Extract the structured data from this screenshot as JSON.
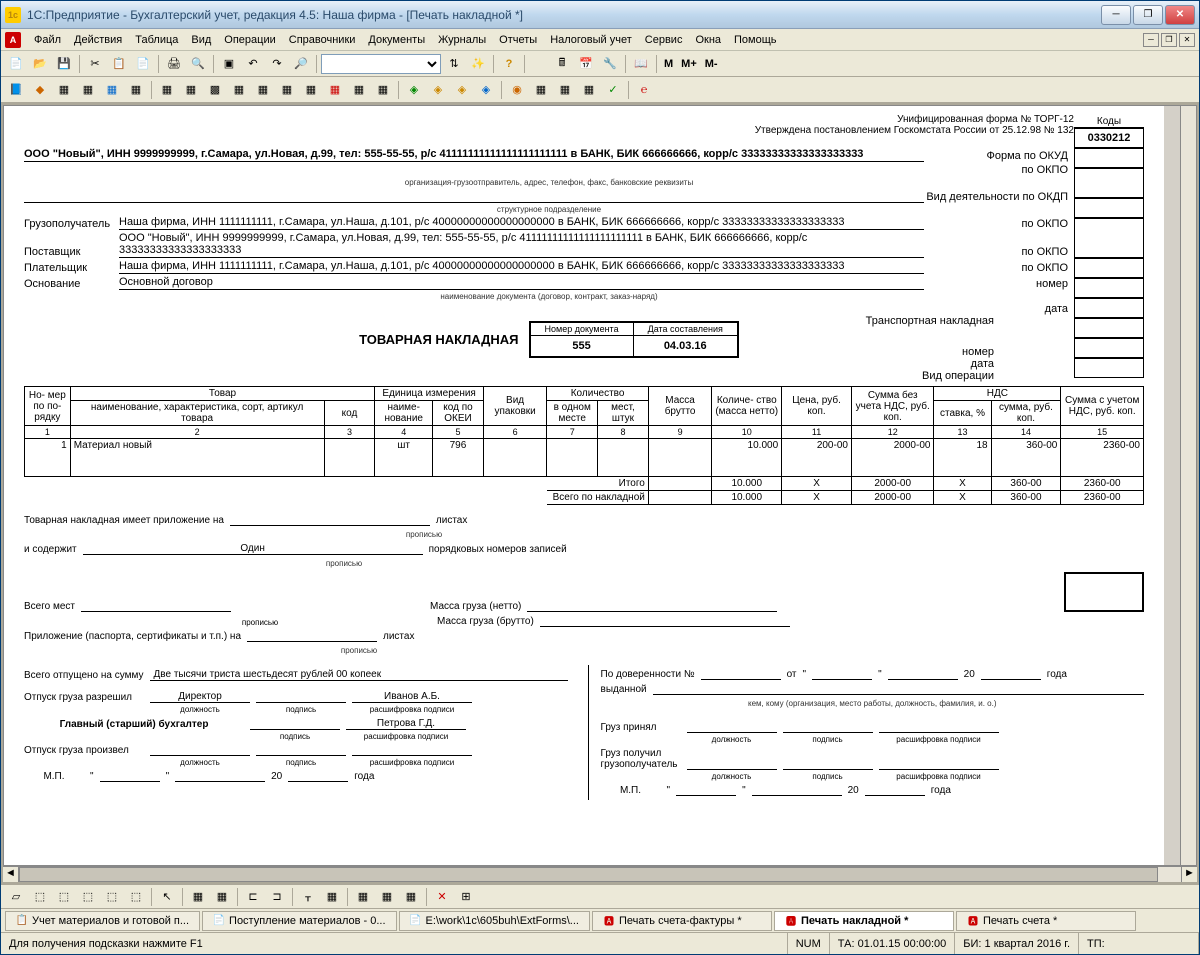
{
  "window": {
    "title": "1С:Предприятие - Бухгалтерский учет, редакция 4.5: Наша фирма - [Печать накладной *]"
  },
  "menu": [
    "Файл",
    "Действия",
    "Таблица",
    "Вид",
    "Операции",
    "Справочники",
    "Документы",
    "Журналы",
    "Отчеты",
    "Налоговый учет",
    "Сервис",
    "Окна",
    "Помощь"
  ],
  "header": {
    "form_line1": "Унифицированная форма № ТОРГ-12",
    "form_line2": "Утверждена постановлением Госкомстата России от 25.12.98 № 132",
    "codes_header": "Коды",
    "okud": "0330212",
    "okud_label": "Форма по ОКУД",
    "okpo_label": "по ОКПО",
    "okdp_label": "Вид деятельности по ОКДП",
    "nomer_label": "номер",
    "data_label": "дата",
    "trans_label": "Транспортная накладная",
    "vid_op_label": "Вид операции"
  },
  "org": {
    "sender": "ООО \"Новый\", ИНН 9999999999, г.Самара, ул.Новая, д.99, тел: 555-55-55, р/с 41111111111111111111111 в БАНК, БИК 666666666, корр/с 33333333333333333333",
    "sender_note": "организация-грузоотправитель, адрес, телефон, факс, банковские реквизиты",
    "struct_note": "структурное подразделение",
    "consignee_label": "Грузополучатель",
    "consignee": "Наша фирма, ИНН 1111111111, г.Самара, ул.Наша, д.101, р/с 40000000000000000000 в БАНК, БИК 666666666, корр/с 33333333333333333333",
    "supplier_label": "Поставщик",
    "supplier": "ООО \"Новый\", ИНН 9999999999, г.Самара, ул.Новая, д.99, тел: 555-55-55, р/с 41111111111111111111111 в БАНК, БИК 666666666, корр/с 33333333333333333333",
    "payer_label": "Плательщик",
    "payer": "Наша фирма, ИНН 1111111111, г.Самара, ул.Наша, д.101, р/с 40000000000000000000 в БАНК, БИК 666666666, корр/с 33333333333333333333",
    "basis_label": "Основание",
    "basis": "Основной договор",
    "basis_note": "наименование документа (договор, контракт, заказ-наряд)"
  },
  "doc": {
    "title": "ТОВАРНАЯ НАКЛАДНАЯ",
    "num_label": "Номер документа",
    "num": "555",
    "date_label": "Дата составления",
    "date": "04.03.16"
  },
  "table": {
    "headers": {
      "h1": "Но-\nмер\nпо по-\nрядку",
      "h2": "Товар",
      "h2a": "наименование, характеристика, сорт,\nартикул товара",
      "h2b": "код",
      "h3": "Единица измерения",
      "h3a": "наиме-\nнование",
      "h3b": "код по\nОКЕИ",
      "h4": "Вид\nупаковки",
      "h5": "Количество",
      "h5a": "в\nодном\nместе",
      "h5b": "мест,\nштук",
      "h6": "Масса\nбрутто",
      "h7": "Количе-\nство\n(масса\nнетто)",
      "h8": "Цена,\nруб. коп.",
      "h9": "Сумма без\nучета НДС,\nруб. коп.",
      "h10": "НДС",
      "h10a": "ставка,\n%",
      "h10b": "сумма,\nруб. коп.",
      "h11": "Сумма с\nучетом\nНДС,\nруб. коп."
    },
    "nums": [
      "1",
      "2",
      "3",
      "4",
      "5",
      "6",
      "7",
      "8",
      "9",
      "10",
      "11",
      "12",
      "13",
      "14",
      "15"
    ],
    "row": {
      "n": "1",
      "name": "Материал новый",
      "code": "",
      "unit": "шт",
      "okei": "796",
      "pack": "",
      "in_one": "",
      "places": "",
      "gross": "",
      "qty": "10.000",
      "price": "200-00",
      "sum_no_vat": "2000-00",
      "vat_rate": "18",
      "vat_sum": "360-00",
      "sum_vat": "2360-00"
    },
    "itogo_label": "Итого",
    "vsego_label": "Всего по накладной",
    "itogo": {
      "qty": "10.000",
      "price": "X",
      "sum_no_vat": "2000-00",
      "vat_rate": "X",
      "vat_sum": "360-00",
      "sum_vat": "2360-00"
    },
    "vsego": {
      "qty": "10.000",
      "price": "X",
      "sum_no_vat": "2000-00",
      "vat_rate": "X",
      "vat_sum": "360-00",
      "sum_vat": "2360-00"
    }
  },
  "footer": {
    "l1": "Товарная накладная имеет приложение на",
    "l1_listah": "листах",
    "l2": "и содержит",
    "l2_odin": "Один",
    "l2_end": "порядковых номеров записей",
    "propis": "прописью",
    "vsego_mest": "Всего мест",
    "massa_netto": "Масса груза (нетто)",
    "massa_brutto": "Масса груза (брутто)",
    "prilozh": "Приложение (паспорта, сертификаты и т.п.) на",
    "listah": "листах",
    "vsego_sum": "Всего отпущено на сумму",
    "sum_words": "Две тысячи триста шестьдесят рублей 00 копеек",
    "otpusk_razr": "Отпуск груза разрешил",
    "director": "Директор",
    "ivanov": "Иванов А.Б.",
    "glav_buh": "Главный (старший) бухгалтер",
    "petrova": "Петрова Г.Д.",
    "otpusk_proizv": "Отпуск груза произвел",
    "dolzhnost": "должность",
    "podpis": "подпись",
    "rasshifr": "расшифровка подписи",
    "mp": "М.П.",
    "goda": "года",
    "20": "20",
    "po_dover": "По доверенности №",
    "ot": "от",
    "vydannoj": "выданной",
    "kem": "кем, кому (организация, место работы, должность, фамилия, и. о.)",
    "gruz_prin": "Груз принял",
    "gruz_poluch": "Груз получил\nгрузополучатель"
  },
  "tabs": [
    {
      "label": "Учет материалов и готовой п...",
      "icon": "📋"
    },
    {
      "label": "Поступление материалов - 0...",
      "icon": "📄"
    },
    {
      "label": "E:\\work\\1c\\605buh\\ExtForms\\...",
      "icon": "📄"
    },
    {
      "label": "Печать счета-фактуры  *",
      "icon": "🅰"
    },
    {
      "label": "Печать накладной  *",
      "icon": "🅰",
      "active": true
    },
    {
      "label": "Печать счета  *",
      "icon": "🅰"
    }
  ],
  "status": {
    "hint": "Для получения подсказки нажмите F1",
    "num": "NUM",
    "ta": "ТА: 01.01.15  00:00:00",
    "bi": "БИ: 1 квартал 2016 г.",
    "tp": "ТП:"
  }
}
